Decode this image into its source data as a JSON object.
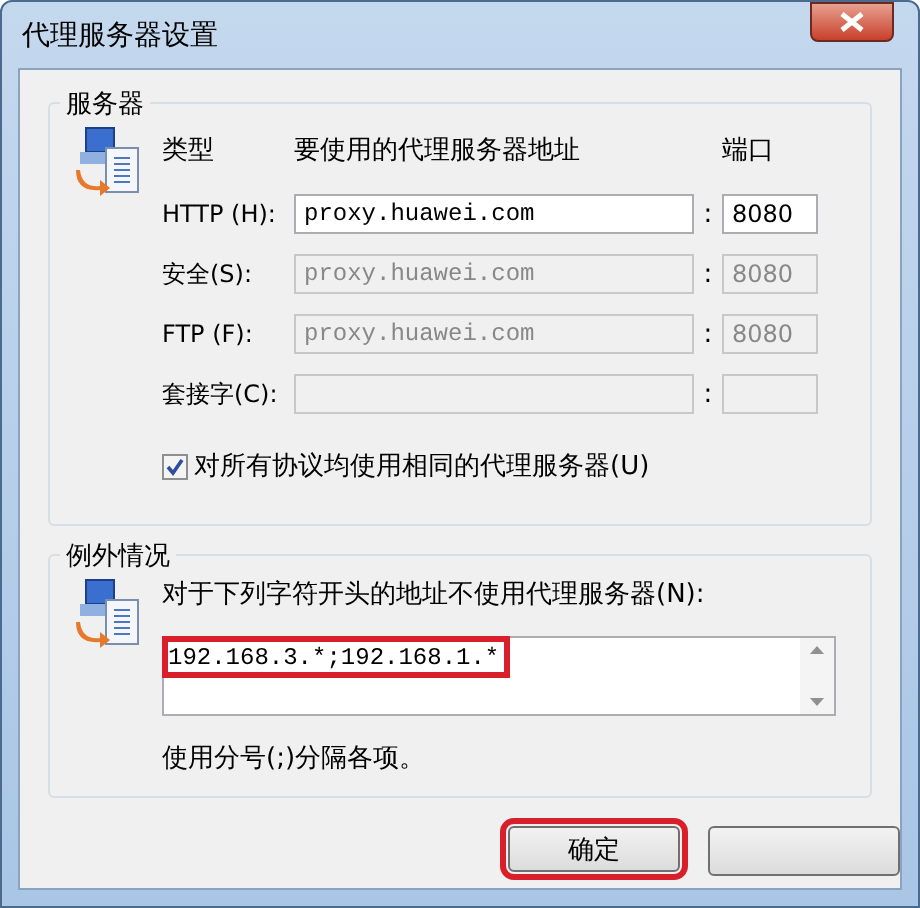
{
  "window": {
    "title": "代理服务器设置"
  },
  "servers": {
    "legend": "服务器",
    "headers": {
      "type": "类型",
      "address": "要使用的代理服务器地址",
      "port": "端口"
    },
    "rows": [
      {
        "label": "HTTP (H):",
        "address": "proxy.huawei.com",
        "separator": ":",
        "port": "8080",
        "disabled": false
      },
      {
        "label": "安全(S):",
        "address": "proxy.huawei.com",
        "separator": ":",
        "port": "8080",
        "disabled": true
      },
      {
        "label": "FTP (F):",
        "address": "proxy.huawei.com",
        "separator": ":",
        "port": "8080",
        "disabled": true
      },
      {
        "label": "套接字(C):",
        "separator": ":",
        "disabled": true
      }
    ],
    "same_for_all": {
      "label": "对所有协议均使用相同的代理服务器(U)",
      "checked": true
    }
  },
  "exceptions": {
    "legend": "例外情况",
    "prompt": "对于下列字符开头的地址不使用代理服务器(N):",
    "value": "192.168.3.*;192.168.1.*",
    "highlighted": true,
    "note": "使用分号(;)分隔各项。"
  },
  "buttons": [
    {
      "label": "确定",
      "highlighted": true
    }
  ]
}
